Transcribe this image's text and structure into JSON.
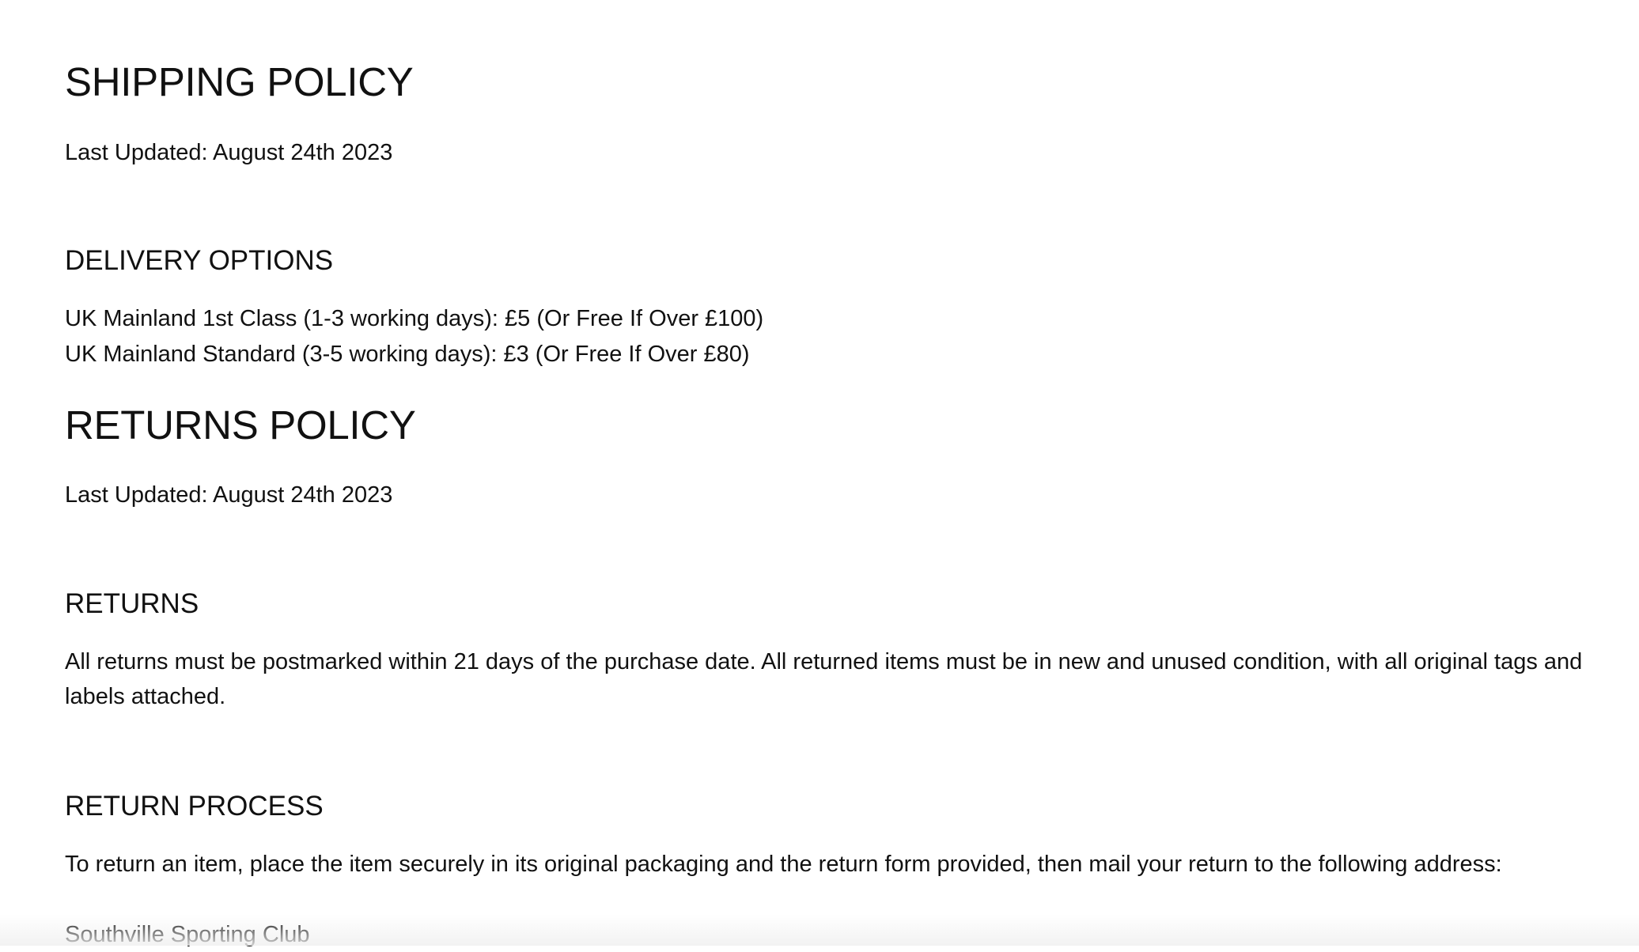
{
  "shipping": {
    "title": "SHIPPING POLICY",
    "last_updated": "Last Updated: August 24th 2023",
    "delivery": {
      "heading": "DELIVERY OPTIONS",
      "options": [
        "UK Mainland 1st Class (1-3 working days): £5 (Or Free If Over £100)",
        "UK Mainland Standard (3-5 working days): £3 (Or Free If Over £80)"
      ]
    }
  },
  "returns": {
    "title": "RETURNS POLICY",
    "last_updated": "Last Updated: August 24th 2023",
    "returns_section": {
      "heading": "RETURNS",
      "body": "All returns must be postmarked within 21 days of the purchase date. All returned items must be in new and unused condition, with all original tags and labels attached."
    },
    "process": {
      "heading": "RETURN PROCESS",
      "body": "To return an item, place the item securely in its original packaging and the return form provided, then mail your return to the following address:",
      "address_line_1": "Southville Sporting Club"
    }
  }
}
